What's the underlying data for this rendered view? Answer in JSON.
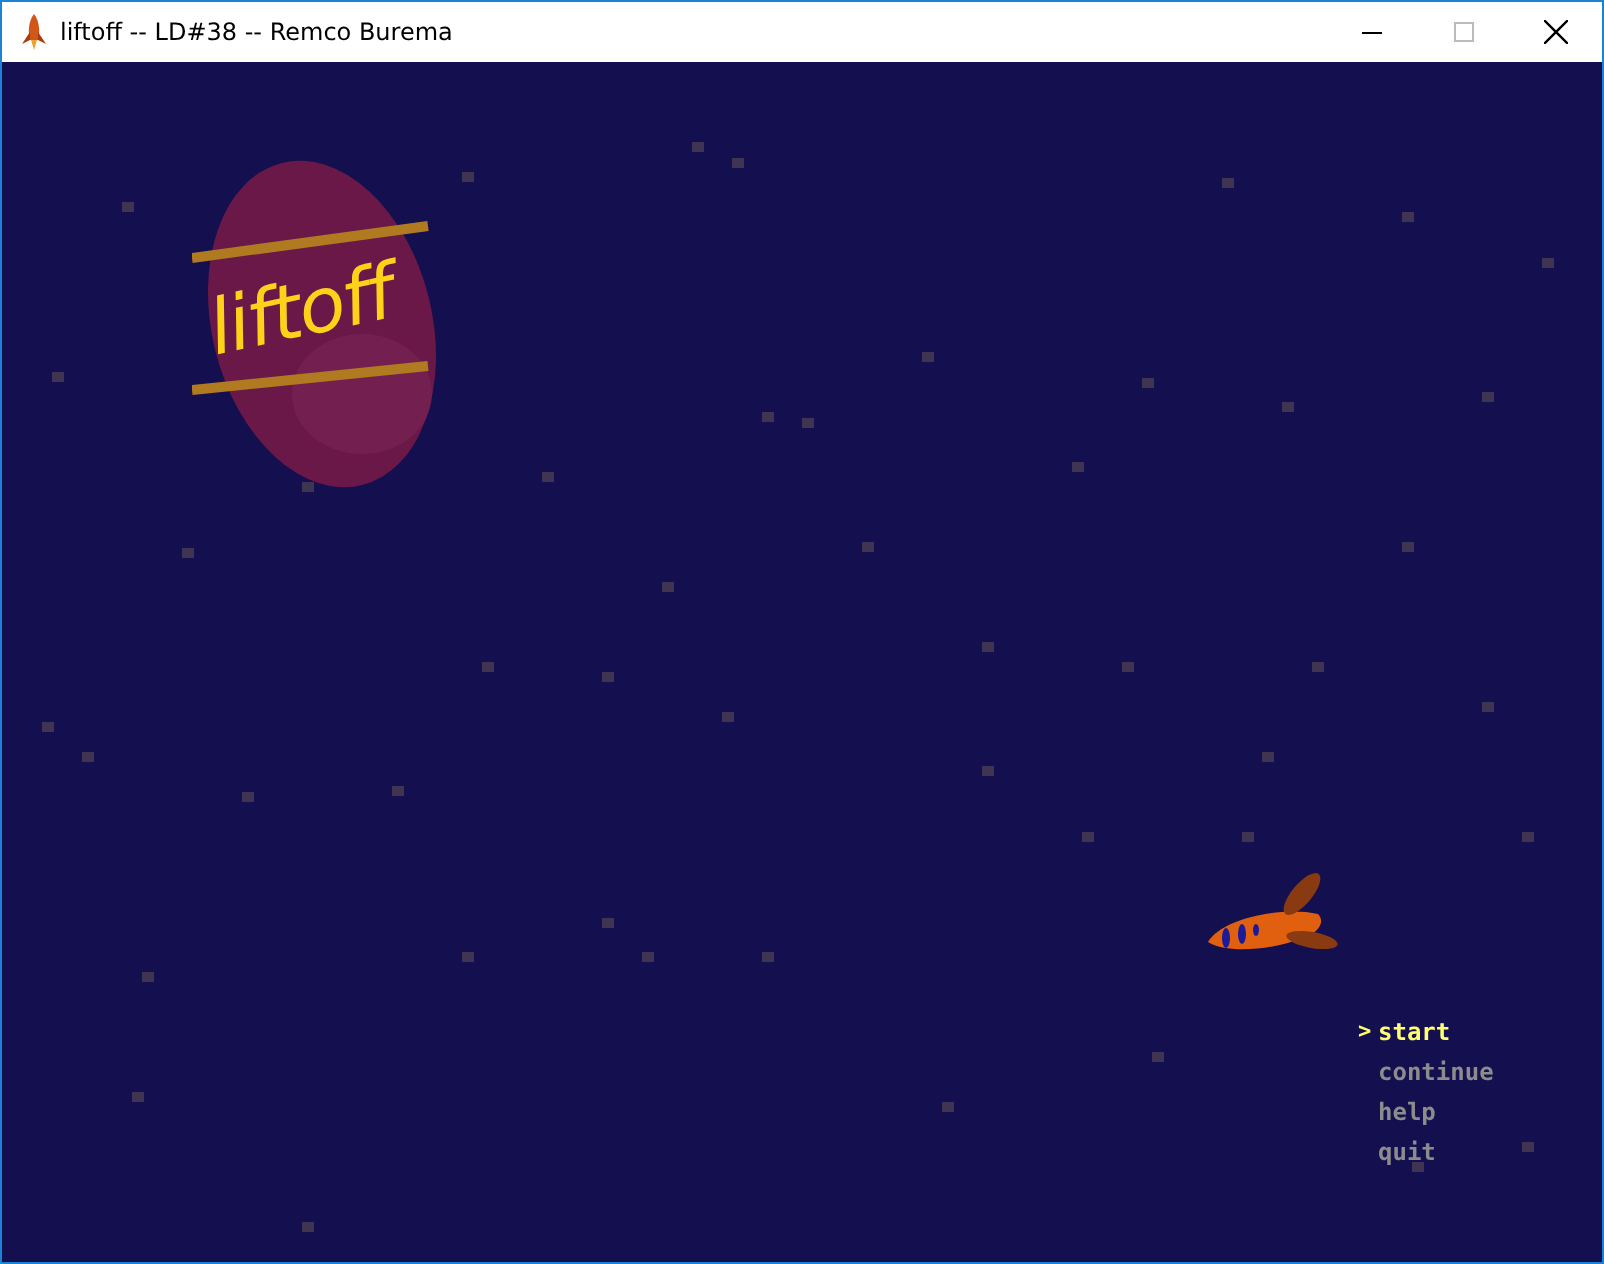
{
  "window": {
    "title": "liftoff -- LD#38 -- Remco Burema"
  },
  "logo": {
    "text": "liftoff"
  },
  "menu": {
    "cursor": ">",
    "items": [
      {
        "label": "start",
        "selected": true
      },
      {
        "label": "continue",
        "selected": false
      },
      {
        "label": "help",
        "selected": false
      },
      {
        "label": "quit",
        "selected": false
      }
    ]
  }
}
